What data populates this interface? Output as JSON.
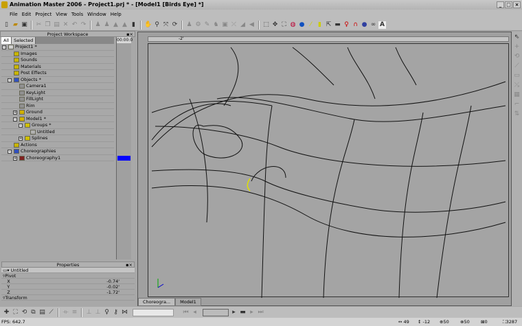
{
  "window": {
    "title": "Animation Master 2006 - Project1.prj * - [Model1 [Birds Eye] *]",
    "controls": [
      "_",
      "□",
      "×"
    ]
  },
  "menu": [
    "File",
    "Edit",
    "Project",
    "View",
    "Tools",
    "Window",
    "Help"
  ],
  "workspace": {
    "title": "Project Workspace",
    "tabs": [
      "All",
      "Selected"
    ],
    "timecode": "00:00:0",
    "tree": [
      {
        "label": "Project1 *",
        "indent": 0,
        "expander": "-",
        "icon": "project-icon",
        "color": "#d0d0d0"
      },
      {
        "label": "Images",
        "indent": 1,
        "icon": "folder-icon",
        "color": "#c8b400"
      },
      {
        "label": "Sounds",
        "indent": 1,
        "icon": "folder-icon",
        "color": "#c8b400"
      },
      {
        "label": "Materials",
        "indent": 1,
        "icon": "folder-icon",
        "color": "#c8b400"
      },
      {
        "label": "Post Effects",
        "indent": 1,
        "icon": "folder-icon",
        "color": "#c8b400"
      },
      {
        "label": "Objects *",
        "indent": 1,
        "expander": "-",
        "icon": "folder-icon",
        "color": "#3050c0"
      },
      {
        "label": "Camera1",
        "indent": 2,
        "icon": "camera-icon",
        "color": "#909090"
      },
      {
        "label": "KeyLight",
        "indent": 2,
        "icon": "light-icon",
        "color": "#909090"
      },
      {
        "label": "FillLight",
        "indent": 2,
        "icon": "light-icon",
        "color": "#909090"
      },
      {
        "label": "Rim",
        "indent": 2,
        "icon": "light-icon",
        "color": "#909090"
      },
      {
        "label": "Ground",
        "indent": 2,
        "expander": "+",
        "icon": "model-icon",
        "color": "#d0b000"
      },
      {
        "label": "Model1 *",
        "indent": 2,
        "expander": "-",
        "icon": "model-icon",
        "color": "#d0b000"
      },
      {
        "label": "Groups *",
        "indent": 3,
        "expander": "-",
        "icon": "folder-icon",
        "color": "#d0c000"
      },
      {
        "label": "Untitled",
        "indent": 4,
        "icon": "group-icon",
        "color": "#b0b0b0"
      },
      {
        "label": "Splines",
        "indent": 3,
        "expander": "+",
        "icon": "folder-icon",
        "color": "#d0c000"
      },
      {
        "label": "Actions",
        "indent": 1,
        "icon": "folder-icon",
        "color": "#c8b400"
      },
      {
        "label": "Choreographies",
        "indent": 1,
        "expander": "-",
        "icon": "folder-icon",
        "color": "#3050c0"
      },
      {
        "label": "Choreography1",
        "indent": 2,
        "expander": "+",
        "icon": "choreography-icon",
        "color": "#802020"
      }
    ],
    "timeline_bar_color": "#0000ff"
  },
  "properties": {
    "title": "Properties",
    "object": "Untitled",
    "section": "Pivot",
    "next_section": "Transform",
    "fields": [
      {
        "label": "X",
        "value": "-0.74'"
      },
      {
        "label": "Y",
        "value": "-0.02'"
      },
      {
        "label": "Z",
        "value": "-1.72'"
      }
    ]
  },
  "viewport": {
    "ruler_mark": "-2'",
    "axis_label": "Z",
    "tabs": [
      "Choreogra...",
      "Model1"
    ]
  },
  "status": {
    "fps": "FPS: 642.7",
    "x": "49",
    "y": "-12",
    "a": "50",
    "b": "50",
    "c": "0",
    "d": "3287"
  }
}
